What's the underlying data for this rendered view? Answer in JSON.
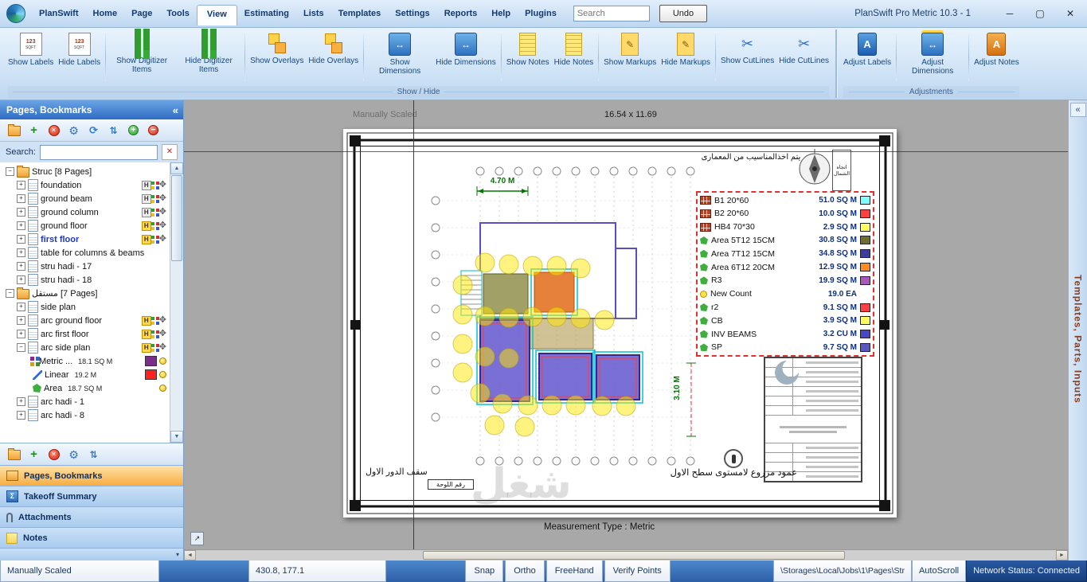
{
  "window": {
    "title": "PlanSwift Pro Metric 10.3 - 1"
  },
  "topbar": {
    "search_placeholder": "Search",
    "undo_label": "Undo",
    "tabs": [
      "PlanSwift",
      "Home",
      "Page",
      "Tools",
      "View",
      "Estimating",
      "Lists",
      "Templates",
      "Settings",
      "Reports",
      "Help",
      "Plugins"
    ],
    "active_tab": "View"
  },
  "ribbon": {
    "groups": [
      {
        "label": "Show / Hide",
        "buttons": [
          {
            "label": "Show Labels",
            "icon": "show-labels-icon"
          },
          {
            "label": "Hide Labels",
            "icon": "hide-labels-icon"
          },
          {
            "label": "Show Digitizer Items",
            "icon": "show-digitizer-icon"
          },
          {
            "label": "Hide Digitizer Items",
            "icon": "hide-digitizer-icon"
          },
          {
            "label": "Show Overlays",
            "icon": "show-overlays-icon"
          },
          {
            "label": "Hide Overlays",
            "icon": "hide-overlays-icon"
          },
          {
            "label": "Show Dimensions",
            "icon": "show-dimensions-icon"
          },
          {
            "label": "Hide Dimensions",
            "icon": "hide-dimensions-icon"
          },
          {
            "label": "Show Notes",
            "icon": "show-notes-icon"
          },
          {
            "label": "Hide Notes",
            "icon": "hide-notes-icon"
          },
          {
            "label": "Show Markups",
            "icon": "show-markups-icon"
          },
          {
            "label": "Hide Markups",
            "icon": "hide-markups-icon"
          },
          {
            "label": "Show CutLines",
            "icon": "show-cutlines-icon"
          },
          {
            "label": "Hide CutLines",
            "icon": "hide-cutlines-icon"
          }
        ]
      },
      {
        "label": "Adjustments",
        "buttons": [
          {
            "label": "Adjust Labels",
            "icon": "adjust-labels-icon"
          },
          {
            "label": "Adjust Dimensions",
            "icon": "adjust-dimensions-icon"
          },
          {
            "label": "Adjust Notes",
            "icon": "adjust-notes-icon"
          }
        ]
      }
    ]
  },
  "sidebar": {
    "title": "Pages, Bookmarks",
    "search_label": "Search:",
    "toolbar_top": [
      "folder-icon",
      "add-icon",
      "delete-icon",
      "settings-icon",
      "refresh-icon",
      "sort-icon",
      "expand-all-icon",
      "collapse-all-icon"
    ],
    "toolbar_bottom": [
      "folder-icon",
      "add-icon",
      "delete-icon",
      "settings-icon",
      "sort-icon"
    ],
    "tree": [
      {
        "type": "folder",
        "label": "Struc [8 Pages]",
        "level": 0,
        "expanded": true
      },
      {
        "type": "page",
        "label": "foundation",
        "level": 1,
        "h": "gray",
        "icons": true
      },
      {
        "type": "page",
        "label": "ground beam",
        "level": 1,
        "h": "gray",
        "icons": true
      },
      {
        "type": "page",
        "label": "ground column",
        "level": 1,
        "h": "gray",
        "icons": true
      },
      {
        "type": "page",
        "label": "ground floor",
        "level": 1,
        "h": "yellow",
        "icons": true
      },
      {
        "type": "page",
        "label": "first floor",
        "level": 1,
        "bold": true,
        "h": "yellow",
        "icons": true
      },
      {
        "type": "page",
        "label": "table for columns & beams",
        "level": 1
      },
      {
        "type": "page",
        "label": "stru hadi - 17",
        "level": 1
      },
      {
        "type": "page",
        "label": "stru hadi - 18",
        "level": 1
      },
      {
        "type": "folder",
        "label": "مستقل [7 Pages]",
        "level": 0,
        "expanded": true
      },
      {
        "type": "page",
        "label": "side plan",
        "level": 1
      },
      {
        "type": "page",
        "label": "arc ground floor",
        "level": 1,
        "h": "yellow",
        "icons": true
      },
      {
        "type": "page",
        "label": "arc first floor",
        "level": 1,
        "h": "yellow",
        "icons": true
      },
      {
        "type": "page",
        "label": "arc side plan",
        "level": 1,
        "h": "yellow",
        "icons": true,
        "expanded": true
      },
      {
        "type": "measure",
        "label": "Metric ...",
        "value": "18.1 SQ M",
        "color": "#7b2d8b",
        "icon": "metric-takeoff-icon",
        "level": 2
      },
      {
        "type": "measure",
        "label": "Linear",
        "value": "19.2 M",
        "color": "#ff2020",
        "icon": "linear-takeoff-icon",
        "level": 2
      },
      {
        "type": "measure",
        "label": "Area",
        "value": "18.7 SQ M",
        "color": null,
        "icon": "area-takeoff-icon",
        "level": 2
      },
      {
        "type": "page",
        "label": "arc hadi - 1",
        "level": 1
      },
      {
        "type": "page",
        "label": "arc hadi - 8",
        "level": 1
      }
    ],
    "panels": [
      {
        "label": "Pages, Bookmarks",
        "icon": "pages-icon",
        "active": true
      },
      {
        "label": "Takeoff Summary",
        "icon": "takeoff-icon",
        "active": false
      },
      {
        "label": "Attachments",
        "icon": "attachment-icon",
        "active": false
      },
      {
        "label": "Notes",
        "icon": "note-icon",
        "active": false
      }
    ]
  },
  "canvas": {
    "scale_status": "Manually Scaled",
    "page_size": "16.54 x 11.69",
    "measurement_type": "Measurement Type : Metric",
    "dim_horizontal": "4.70 M",
    "dim_vertical": "3.10 M",
    "note_ar": "يتم اخذالمناسيب من المعمارى",
    "north_label_ar": "اتجاه الشمال",
    "footer_left_ar": "سقف الدور الاول",
    "footer_box_ar": "رقم اللوحة",
    "footer_right_ar": "عمود مزروع لامستوى سطح الاول",
    "watermark_ar": "شغل",
    "legend": [
      {
        "name": "B1 20*60",
        "value": "51.0 SQ M",
        "swatch": "#7dffff",
        "icon": "beam-item-icon"
      },
      {
        "name": "B2 20*60",
        "value": "10.0 SQ M",
        "swatch": "#ff4040",
        "icon": "beam-item-icon"
      },
      {
        "name": "HB4 70*30",
        "value": "2.9 SQ M",
        "swatch": "#ffff60",
        "icon": "beam-item-icon"
      },
      {
        "name": "Area 5T12 15CM",
        "value": "30.8 SQ M",
        "swatch": "#6d7030",
        "icon": "area-item-icon"
      },
      {
        "name": "Area 7T12 15CM",
        "value": "34.8 SQ M",
        "swatch": "#3c3c9e",
        "icon": "area-item-icon"
      },
      {
        "name": "Area 6T12 20CM",
        "value": "12.9 SQ M",
        "swatch": "#ff8c20",
        "icon": "area-item-icon"
      },
      {
        "name": "R3",
        "value": "19.9 SQ M",
        "swatch": "#a85ab8",
        "icon": "area-item-icon"
      },
      {
        "name": "New Count",
        "value": "19.0 EA",
        "swatch": null,
        "icon": "count-item-icon"
      },
      {
        "name": "r2",
        "value": "9.1 SQ M",
        "swatch": "#ff4040",
        "icon": "area-item-icon"
      },
      {
        "name": "CB",
        "value": "3.9 SQ M",
        "swatch": "#ffff60",
        "icon": "area-item-icon"
      },
      {
        "name": "INV BEAMS",
        "value": "3.2 CU M",
        "swatch": "#4848c8",
        "icon": "area-item-icon"
      },
      {
        "name": "SP",
        "value": "9.7 SQ M",
        "swatch": "#5858c0",
        "icon": "area-item-icon"
      }
    ]
  },
  "right_panel": {
    "tab_label": "Templates, Parts, Inputs"
  },
  "statusbar": {
    "scale_status": "Manually Scaled",
    "coordinates": "430.8, 177.1",
    "toggles": [
      "Snap",
      "Ortho",
      "FreeHand",
      "Verify Points"
    ],
    "path": "\\Storages\\Local\\Jobs\\1\\Pages\\Str",
    "autoscroll_label": "AutoScroll",
    "network_status": "Network Status: Connected"
  },
  "colors": {
    "accent_orange": "#f7ad42",
    "header_blue": "#2e6cc4",
    "status_navy": "#153f7e"
  }
}
